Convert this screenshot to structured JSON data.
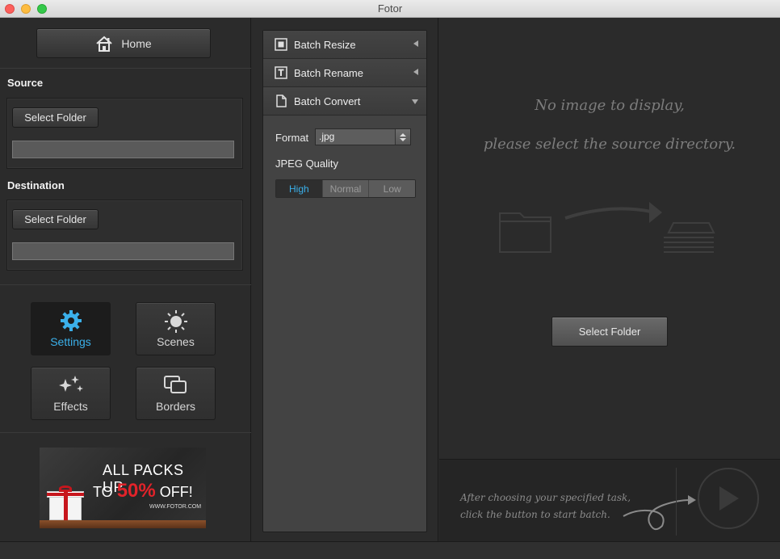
{
  "window": {
    "title": "Fotor"
  },
  "left": {
    "home_label": "Home",
    "source": {
      "label": "Source",
      "button": "Select Folder",
      "path": ""
    },
    "destination": {
      "label": "Destination",
      "button": "Select Folder",
      "path": ""
    },
    "tools": [
      {
        "label": "Settings",
        "icon": "gear-icon",
        "active": true
      },
      {
        "label": "Scenes",
        "icon": "sun-icon",
        "active": false
      },
      {
        "label": "Effects",
        "icon": "sparkle-icon",
        "active": false
      },
      {
        "label": "Borders",
        "icon": "borders-icon",
        "active": false
      }
    ],
    "ad": {
      "line1": "ALL PACKS UP",
      "line2_prefix": "TO",
      "line2_highlight": "50%",
      "line2_suffix": "OFF!",
      "url": "WWW.FOTOR.COM"
    }
  },
  "middle": {
    "items": [
      {
        "label": "Batch Resize",
        "icon": "resize-icon",
        "expanded": false
      },
      {
        "label": "Batch Rename",
        "icon": "rename-icon",
        "expanded": false
      },
      {
        "label": "Batch Convert",
        "icon": "document-icon",
        "expanded": true
      }
    ],
    "format_label": "Format",
    "format_value": ".jpg",
    "jpeg_quality_label": "JPEG Quality",
    "quality_options": [
      "High",
      "Normal",
      "Low"
    ],
    "quality_selected": "High"
  },
  "right": {
    "message_line1": "No image to display,",
    "message_line2": "please select the source directory.",
    "select_button": "Select Folder",
    "hint_line1": "After choosing your specified task,",
    "hint_line2": "click the button to start batch."
  },
  "colors": {
    "accent": "#3bb0ea",
    "ad_highlight": "#e2232a"
  }
}
